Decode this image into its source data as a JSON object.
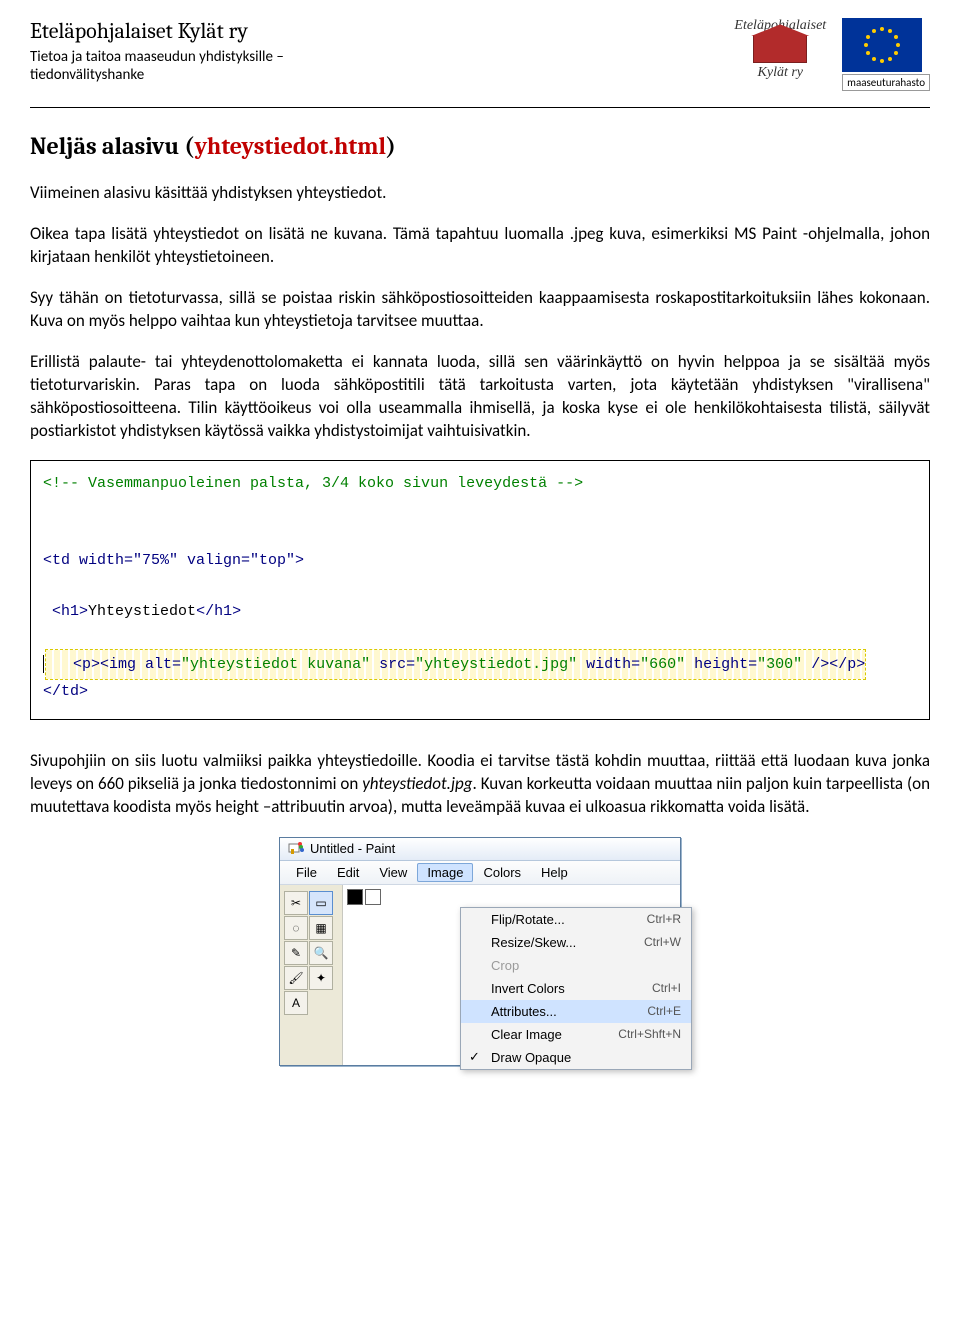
{
  "header": {
    "org_name": "Eteläpohjalaiset Kylät ry",
    "sub_line1": "Tietoa ja taitoa maaseudun yhdistyksille –",
    "sub_line2": "tiedonvälityshanke",
    "logo1_top": "Eteläpohjalaiset",
    "logo1_bottom": "Kylät ry",
    "eu_caption": "maaseuturahasto"
  },
  "section": {
    "title_prefix": "Neljäs alasivu (",
    "title_red": "yhteystiedot.html",
    "title_suffix": ")"
  },
  "para1": "Viimeinen alasivu käsittää yhdistyksen yhteystiedot.",
  "para2": "Oikea tapa lisätä yhteystiedot on lisätä ne kuvana. Tämä tapahtuu luomalla .jpeg kuva, esimerkiksi MS Paint -ohjelmalla, johon kirjataan henkilöt yhteystietoineen.",
  "para3": "Syy tähän on tietoturvassa, sillä se poistaa riskin sähköpostiosoitteiden kaappaamisesta roskapostitarkoituksiin lähes kokonaan. Kuva on myös helppo vaihtaa kun yhteystietoja tarvitsee muuttaa.",
  "para4": "Erillistä palaute- tai yhteydenottolomaketta ei kannata luoda, sillä sen väärinkäyttö on hyvin helppoa ja se sisältää myös tietoturvariskin. Paras tapa on luoda sähköpostitili tätä tarkoitusta varten, jota käytetään yhdistyksen \"virallisena\" sähköpostiosoitteena. Tilin käyttöoikeus voi olla useammalla ihmisellä, ja koska kyse ei ole henkilökohtaisesta tilistä, säilyvät postiarkistot yhdistyksen käytössä vaikka yhdistystoimijat vaihtuisivatkin.",
  "code": {
    "comment": "<!-- Vasemmanpuoleinen palsta, 3/4 koko sivun leveydestä -->",
    "td_open": "<td width=\"75%\" valign=\"top\">",
    "h1": "<h1>Yhteystiedot</h1>",
    "img_line_pre": "<p><img ",
    "img_alt_k": "alt=",
    "img_alt_v": "\"yhteystiedot kuvana\"",
    "img_src_k": " src=",
    "img_src_v": "\"yhteystiedot.jpg\"",
    "img_w_k": " width=",
    "img_w_v": "\"660\"",
    "img_h_k": " height=",
    "img_h_v": "\"300\"",
    "img_tail": " /></p>",
    "td_close": "</td>"
  },
  "para5_a": "Sivupohjiin on siis luotu valmiiksi paikka yhteystiedoille. Koodia ei tarvitse tästä kohdin muuttaa, riittää että luodaan kuva jonka leveys on 660 pikseliä ja jonka tiedostonnimi on ",
  "para5_file": "yhteystiedot.jpg",
  "para5_b": ". Kuvan korkeutta voidaan muuttaa niin paljon kuin tarpeellista (on muutettava koodista myös height –attribuutin arvoa), mutta leveämpää kuvaa ei ulkoasua rikkomatta voida lisätä.",
  "paint": {
    "title": "Untitled - Paint",
    "menu": [
      "File",
      "Edit",
      "View",
      "Image",
      "Colors",
      "Help"
    ],
    "active_menu_index": 3,
    "dropdown": [
      {
        "label": "Flip/Rotate...",
        "shortcut": "Ctrl+R"
      },
      {
        "label": "Resize/Skew...",
        "shortcut": "Ctrl+W"
      },
      {
        "label": "Crop",
        "shortcut": "",
        "disabled": true
      },
      {
        "label": "Invert Colors",
        "shortcut": "Ctrl+I"
      },
      {
        "label": "Attributes...",
        "shortcut": "Ctrl+E",
        "highlight": true
      },
      {
        "label": "Clear Image",
        "shortcut": "Ctrl+Shft+N"
      },
      {
        "label": "Draw Opaque",
        "shortcut": "",
        "checked": true
      }
    ],
    "tools": [
      {
        "glyph": "✂",
        "name": "freeform-select"
      },
      {
        "glyph": "▭",
        "name": "select",
        "selected": true
      },
      {
        "glyph": "◌",
        "name": "eraser"
      },
      {
        "glyph": "▦",
        "name": "fill"
      },
      {
        "glyph": "✎",
        "name": "pencil"
      },
      {
        "glyph": "🔍",
        "name": "magnifier"
      },
      {
        "glyph": "🖌",
        "name": "brush"
      },
      {
        "glyph": "✦",
        "name": "airbrush"
      },
      {
        "glyph": "A",
        "name": "text"
      }
    ]
  }
}
